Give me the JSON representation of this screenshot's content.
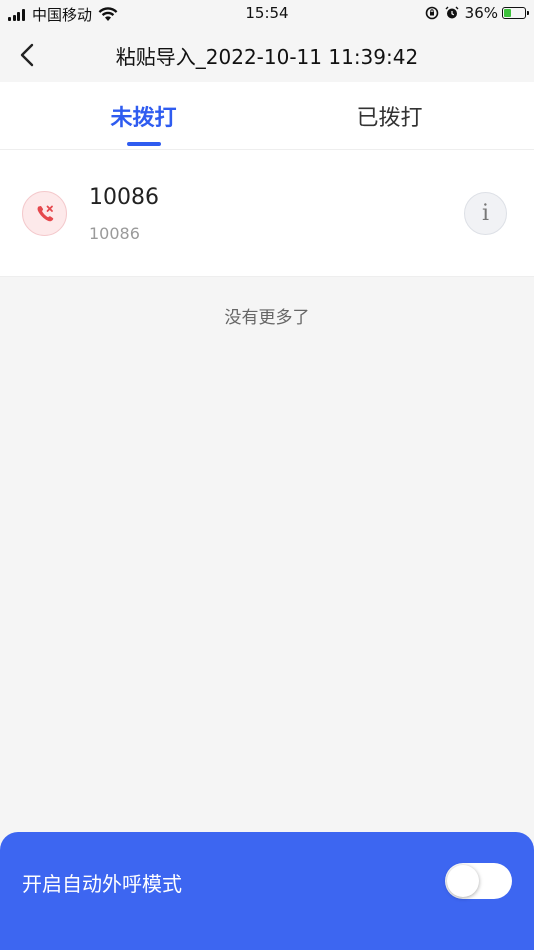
{
  "status_bar": {
    "carrier": "中国移动",
    "time": "15:54",
    "battery": "36%",
    "battery_level": 0.36,
    "icons": [
      "signal-icon",
      "wifi-icon",
      "rotation-lock-icon",
      "alarm-icon",
      "battery-charging-icon"
    ]
  },
  "nav": {
    "title": "粘贴导入_2022-10-11 11:39:42",
    "back_icon": "chevron-left-icon"
  },
  "tabs": [
    {
      "label": "未拨打",
      "active": true
    },
    {
      "label": "已拨打",
      "active": false
    }
  ],
  "contacts": [
    {
      "name": "10086",
      "number": "10086",
      "status_icon": "missed-call-icon",
      "info_label": "i"
    }
  ],
  "list_footer": "没有更多了",
  "auto_dial": {
    "label": "开启自动外呼模式",
    "enabled": false
  },
  "colors": {
    "accent": "#2f5cf0",
    "panel": "#3d66f1",
    "missed_call": "#e5484d",
    "background": "#f5f5f5"
  }
}
